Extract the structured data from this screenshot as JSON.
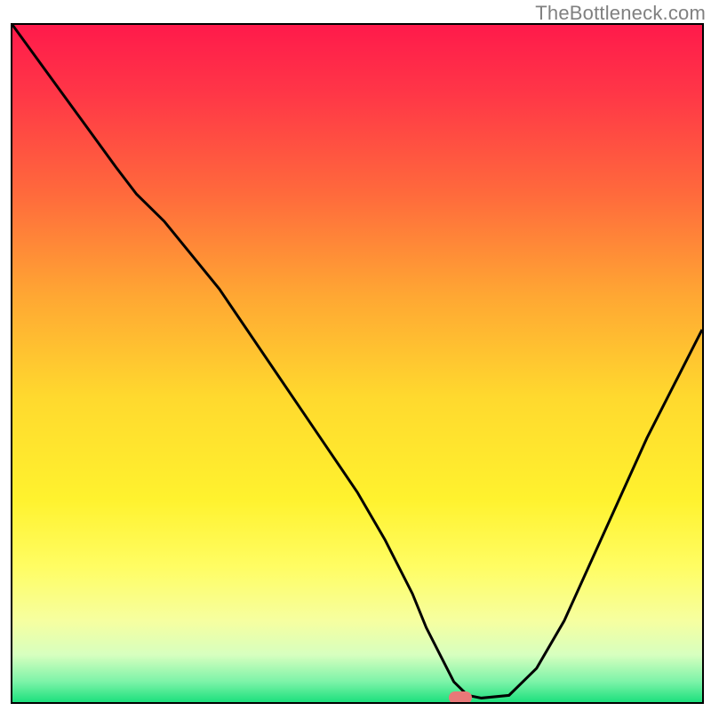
{
  "watermark": "TheBottleneck.com",
  "colors": {
    "frame": "#000000",
    "marker": "#e97878",
    "curve": "#000000"
  },
  "chart_data": {
    "type": "line",
    "title": "",
    "xlabel": "",
    "ylabel": "",
    "xlim": [
      0,
      100
    ],
    "ylim": [
      0,
      100
    ],
    "x": [
      0,
      5,
      10,
      15,
      18,
      22,
      26,
      30,
      34,
      38,
      42,
      46,
      50,
      54,
      58,
      60,
      62,
      64,
      66,
      68,
      72,
      76,
      80,
      84,
      88,
      92,
      96,
      100
    ],
    "y": [
      100,
      93,
      86,
      79,
      75,
      71,
      66,
      61,
      55,
      49,
      43,
      37,
      31,
      24,
      16,
      11,
      7,
      3,
      1,
      0.6,
      1,
      5,
      12,
      21,
      30,
      39,
      47,
      55
    ],
    "marker": {
      "x": 65,
      "y": 0.6
    },
    "gradient_stops": [
      {
        "offset": 0.0,
        "color": "#ff1a4b"
      },
      {
        "offset": 0.1,
        "color": "#ff3647"
      },
      {
        "offset": 0.25,
        "color": "#ff6a3c"
      },
      {
        "offset": 0.4,
        "color": "#ffa733"
      },
      {
        "offset": 0.55,
        "color": "#ffd92e"
      },
      {
        "offset": 0.7,
        "color": "#fff22e"
      },
      {
        "offset": 0.8,
        "color": "#fffd63"
      },
      {
        "offset": 0.88,
        "color": "#f6ffa0"
      },
      {
        "offset": 0.93,
        "color": "#d7ffbf"
      },
      {
        "offset": 0.97,
        "color": "#7cf3a8"
      },
      {
        "offset": 1.0,
        "color": "#1de07d"
      }
    ]
  }
}
